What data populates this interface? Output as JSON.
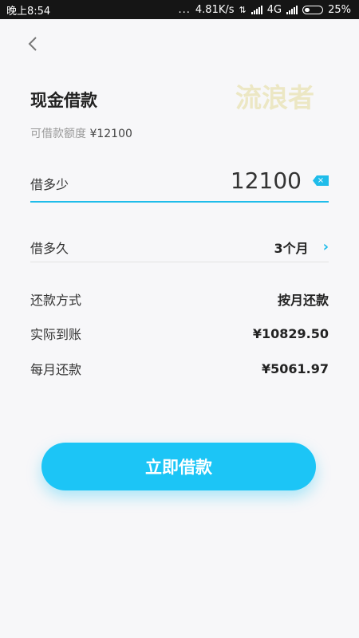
{
  "status_bar": {
    "time": "晚上8:54",
    "dots": "...",
    "network_speed": "4.81K/s",
    "network_type": "4G",
    "battery": "25%"
  },
  "header": {
    "back_icon": "chevron-left-icon",
    "title": "现金借款",
    "watermark": "流浪者"
  },
  "quota": {
    "label": "可借款额度",
    "amount": "¥12100"
  },
  "amount": {
    "label": "借多少",
    "value": "12100",
    "clear_icon": "backspace-icon"
  },
  "term": {
    "label": "借多久",
    "value": "3个月"
  },
  "details": {
    "repay_method_label": "还款方式",
    "repay_method_value": "按月还款",
    "actual_label": "实际到账",
    "actual_value": "¥10829.50",
    "monthly_label": "每月还款",
    "monthly_value": "¥5061.97"
  },
  "action": {
    "loan_button": "立即借款"
  },
  "colors": {
    "accent": "#1fbcea",
    "button": "#1cc5f6",
    "status_bar": "#151515",
    "background": "#f7f7f9"
  }
}
